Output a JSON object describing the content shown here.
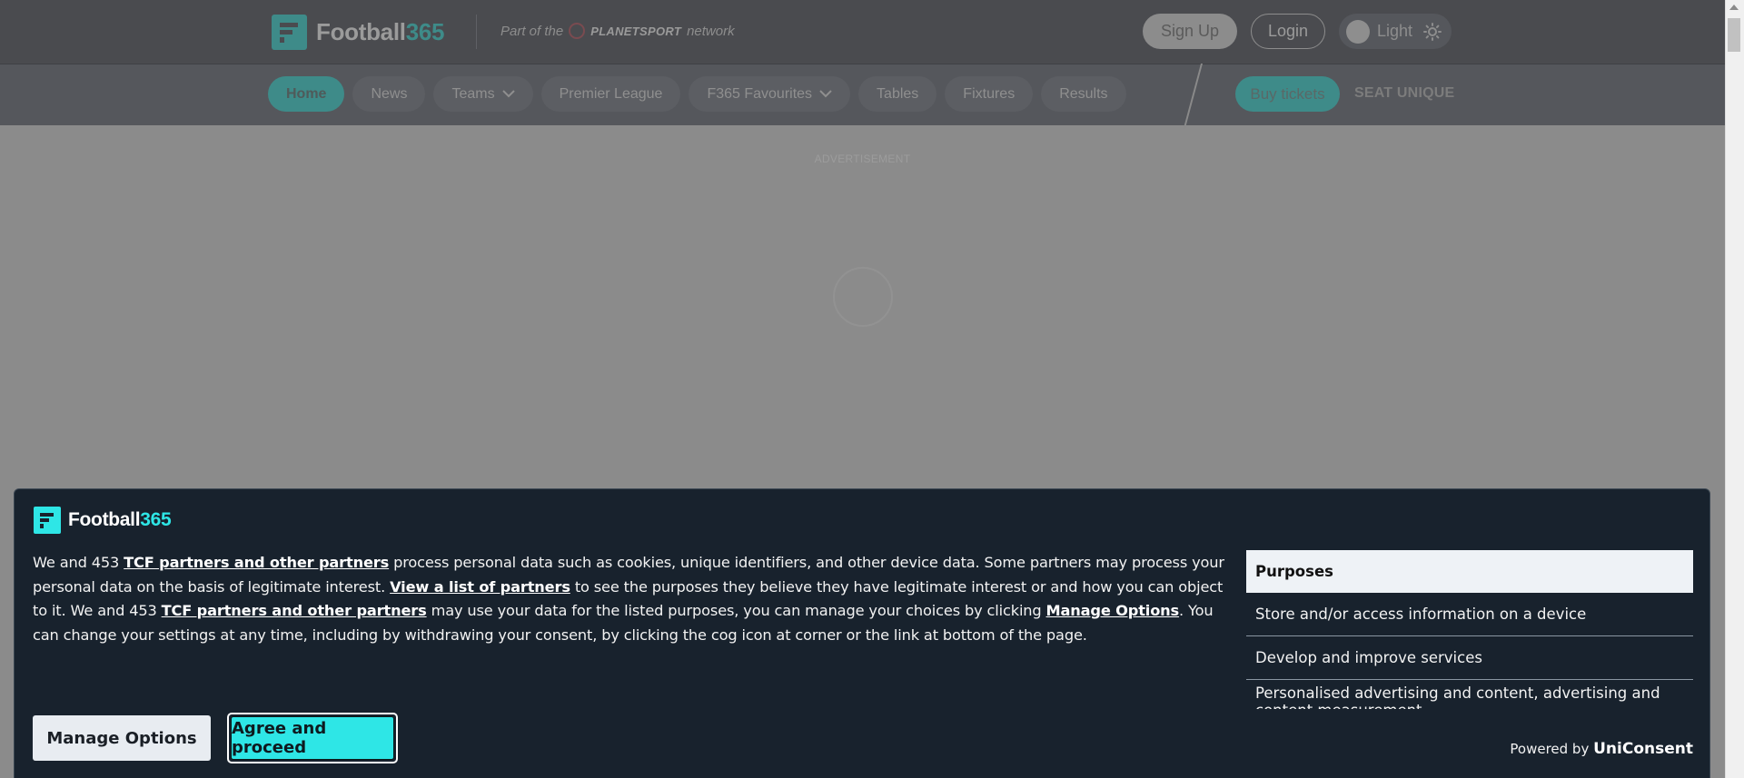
{
  "header": {
    "logo_prefix": "Football",
    "logo_suffix": "365",
    "partof_pre": "Part of the",
    "partof_brand": "PLANETSPORT",
    "partof_post": "network",
    "signup_label": "Sign Up",
    "login_label": "Login",
    "theme_label": "Light"
  },
  "nav": {
    "items": [
      {
        "label": "Home"
      },
      {
        "label": "News"
      },
      {
        "label": "Teams"
      },
      {
        "label": "Premier League"
      },
      {
        "label": "F365 Favourites"
      },
      {
        "label": "Tables"
      },
      {
        "label": "Fixtures"
      },
      {
        "label": "Results"
      }
    ],
    "buy_tickets": "Buy tickets",
    "seat_unique": "SEAT UNIQUE"
  },
  "ad": {
    "label": "ADVERTISEMENT"
  },
  "consent": {
    "brand_prefix": "Football",
    "brand_suffix": "365",
    "t1": "We and 453 ",
    "link_partners": "TCF partners and other partners",
    "t2": " process personal data such as cookies, unique identifiers, and other device data. Some partners may process your personal data on the basis of legitimate interest. ",
    "link_list": "View a list of partners",
    "t3": " to see the purposes they believe they have legitimate interest or and how you can object to it. We and 453 ",
    "link_partners2": "TCF partners and other partners",
    "t4": " may use your data for the listed purposes, you can manage your choices by clicking ",
    "link_manage": "Manage Options",
    "t5": ". You can change your settings at any time, including by withdrawing your consent, by clicking the cog icon at corner or the link at bottom of the page.",
    "purposes_title": "Purposes",
    "purposes": [
      "Store and/or access information on a device",
      "Develop and improve services",
      "Personalised advertising and content, advertising and content measurement"
    ],
    "manage_label": "Manage Options",
    "agree_label": "Agree and proceed",
    "powered_by": "Powered by",
    "powered_brand": "UniConsent"
  },
  "colors": {
    "accent": "#2ee6e6",
    "banner_bg": "#18222d",
    "site_accent": "#3e8b89"
  }
}
